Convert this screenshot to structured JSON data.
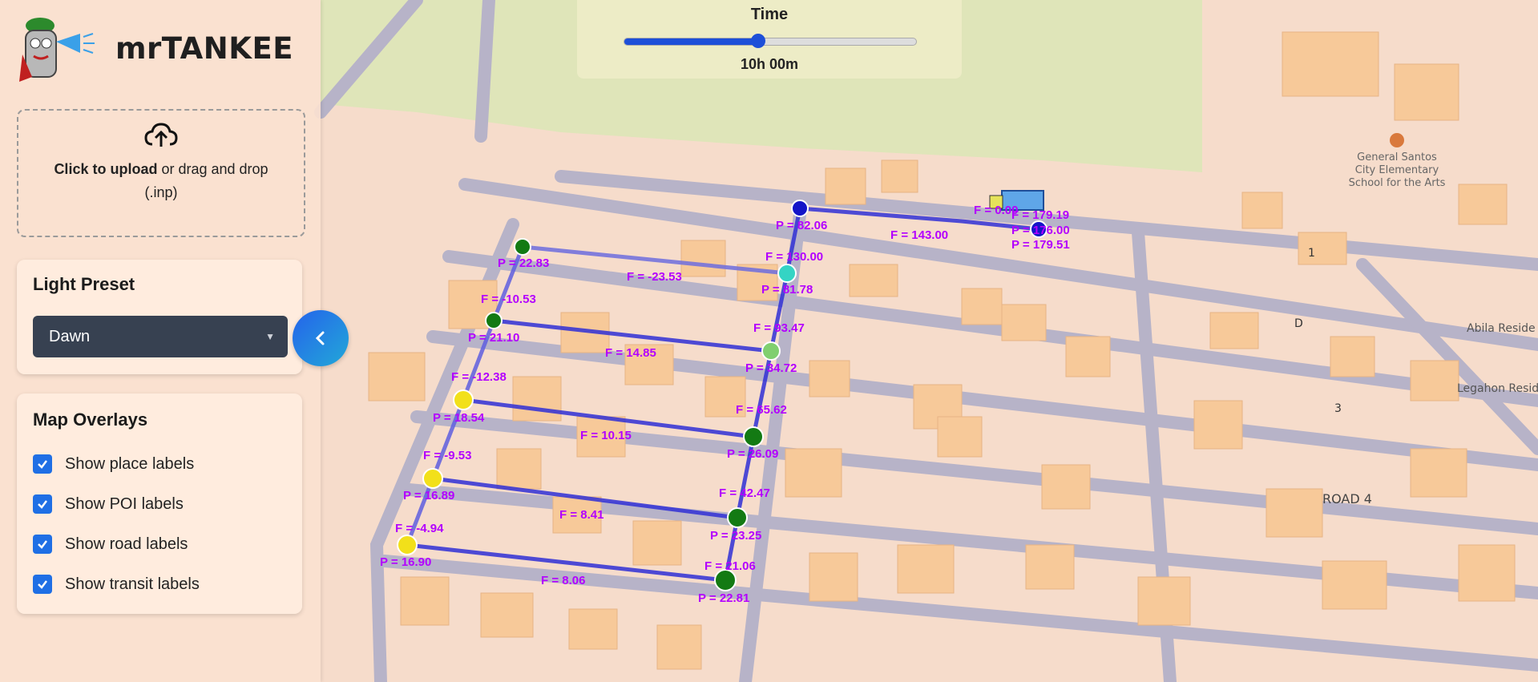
{
  "app": {
    "title": "mrTANKEE"
  },
  "upload": {
    "bold": "Click to upload",
    "rest": " or drag and drop",
    "ext": "(.inp)",
    "icon": "cloud-upload-icon"
  },
  "light_preset": {
    "heading": "Light Preset",
    "selected": "Dawn"
  },
  "overlays": {
    "heading": "Map Overlays",
    "items": [
      {
        "label": "Show place labels",
        "checked": true
      },
      {
        "label": "Show POI labels",
        "checked": true
      },
      {
        "label": "Show road labels",
        "checked": true
      },
      {
        "label": "Show transit labels",
        "checked": true
      }
    ]
  },
  "time": {
    "label": "Time",
    "value": "10h 00m",
    "progress": 0.46
  },
  "map": {
    "place_labels": [
      "General Santos",
      "City Elementary",
      "School for the Arts",
      "Abila Reside",
      "Legahon Resid"
    ],
    "road_labels": [
      "ROAD 4",
      "1",
      "D",
      "3"
    ],
    "flow_labels": [
      "F = 143.00",
      "F = 130.00",
      "F = -23.53",
      "F = -10.53",
      "F = 93.47",
      "F = 14.85",
      "F = -12.38",
      "F = 65.62",
      "F = 10.15",
      "F = -9.53",
      "F = 42.47",
      "F = 8.41",
      "F = -4.94",
      "F = 21.06",
      "F = 8.06",
      "F = 0.00",
      "F = 179.19"
    ],
    "pressure_labels": [
      "P = 82.06",
      "P = 22.83",
      "P = 81.78",
      "P = 21.10",
      "P = 34.72",
      "P = 18.54",
      "P = 26.09",
      "P = 16.89",
      "P = 23.25",
      "P = 16.90",
      "P = 22.81",
      "P = 176.00",
      "P = 179.51"
    ]
  },
  "colors": {
    "accent": "#1d4fd8",
    "select_bg": "#374151",
    "pipe": "#2b2bd8",
    "label": "#b300ff"
  }
}
